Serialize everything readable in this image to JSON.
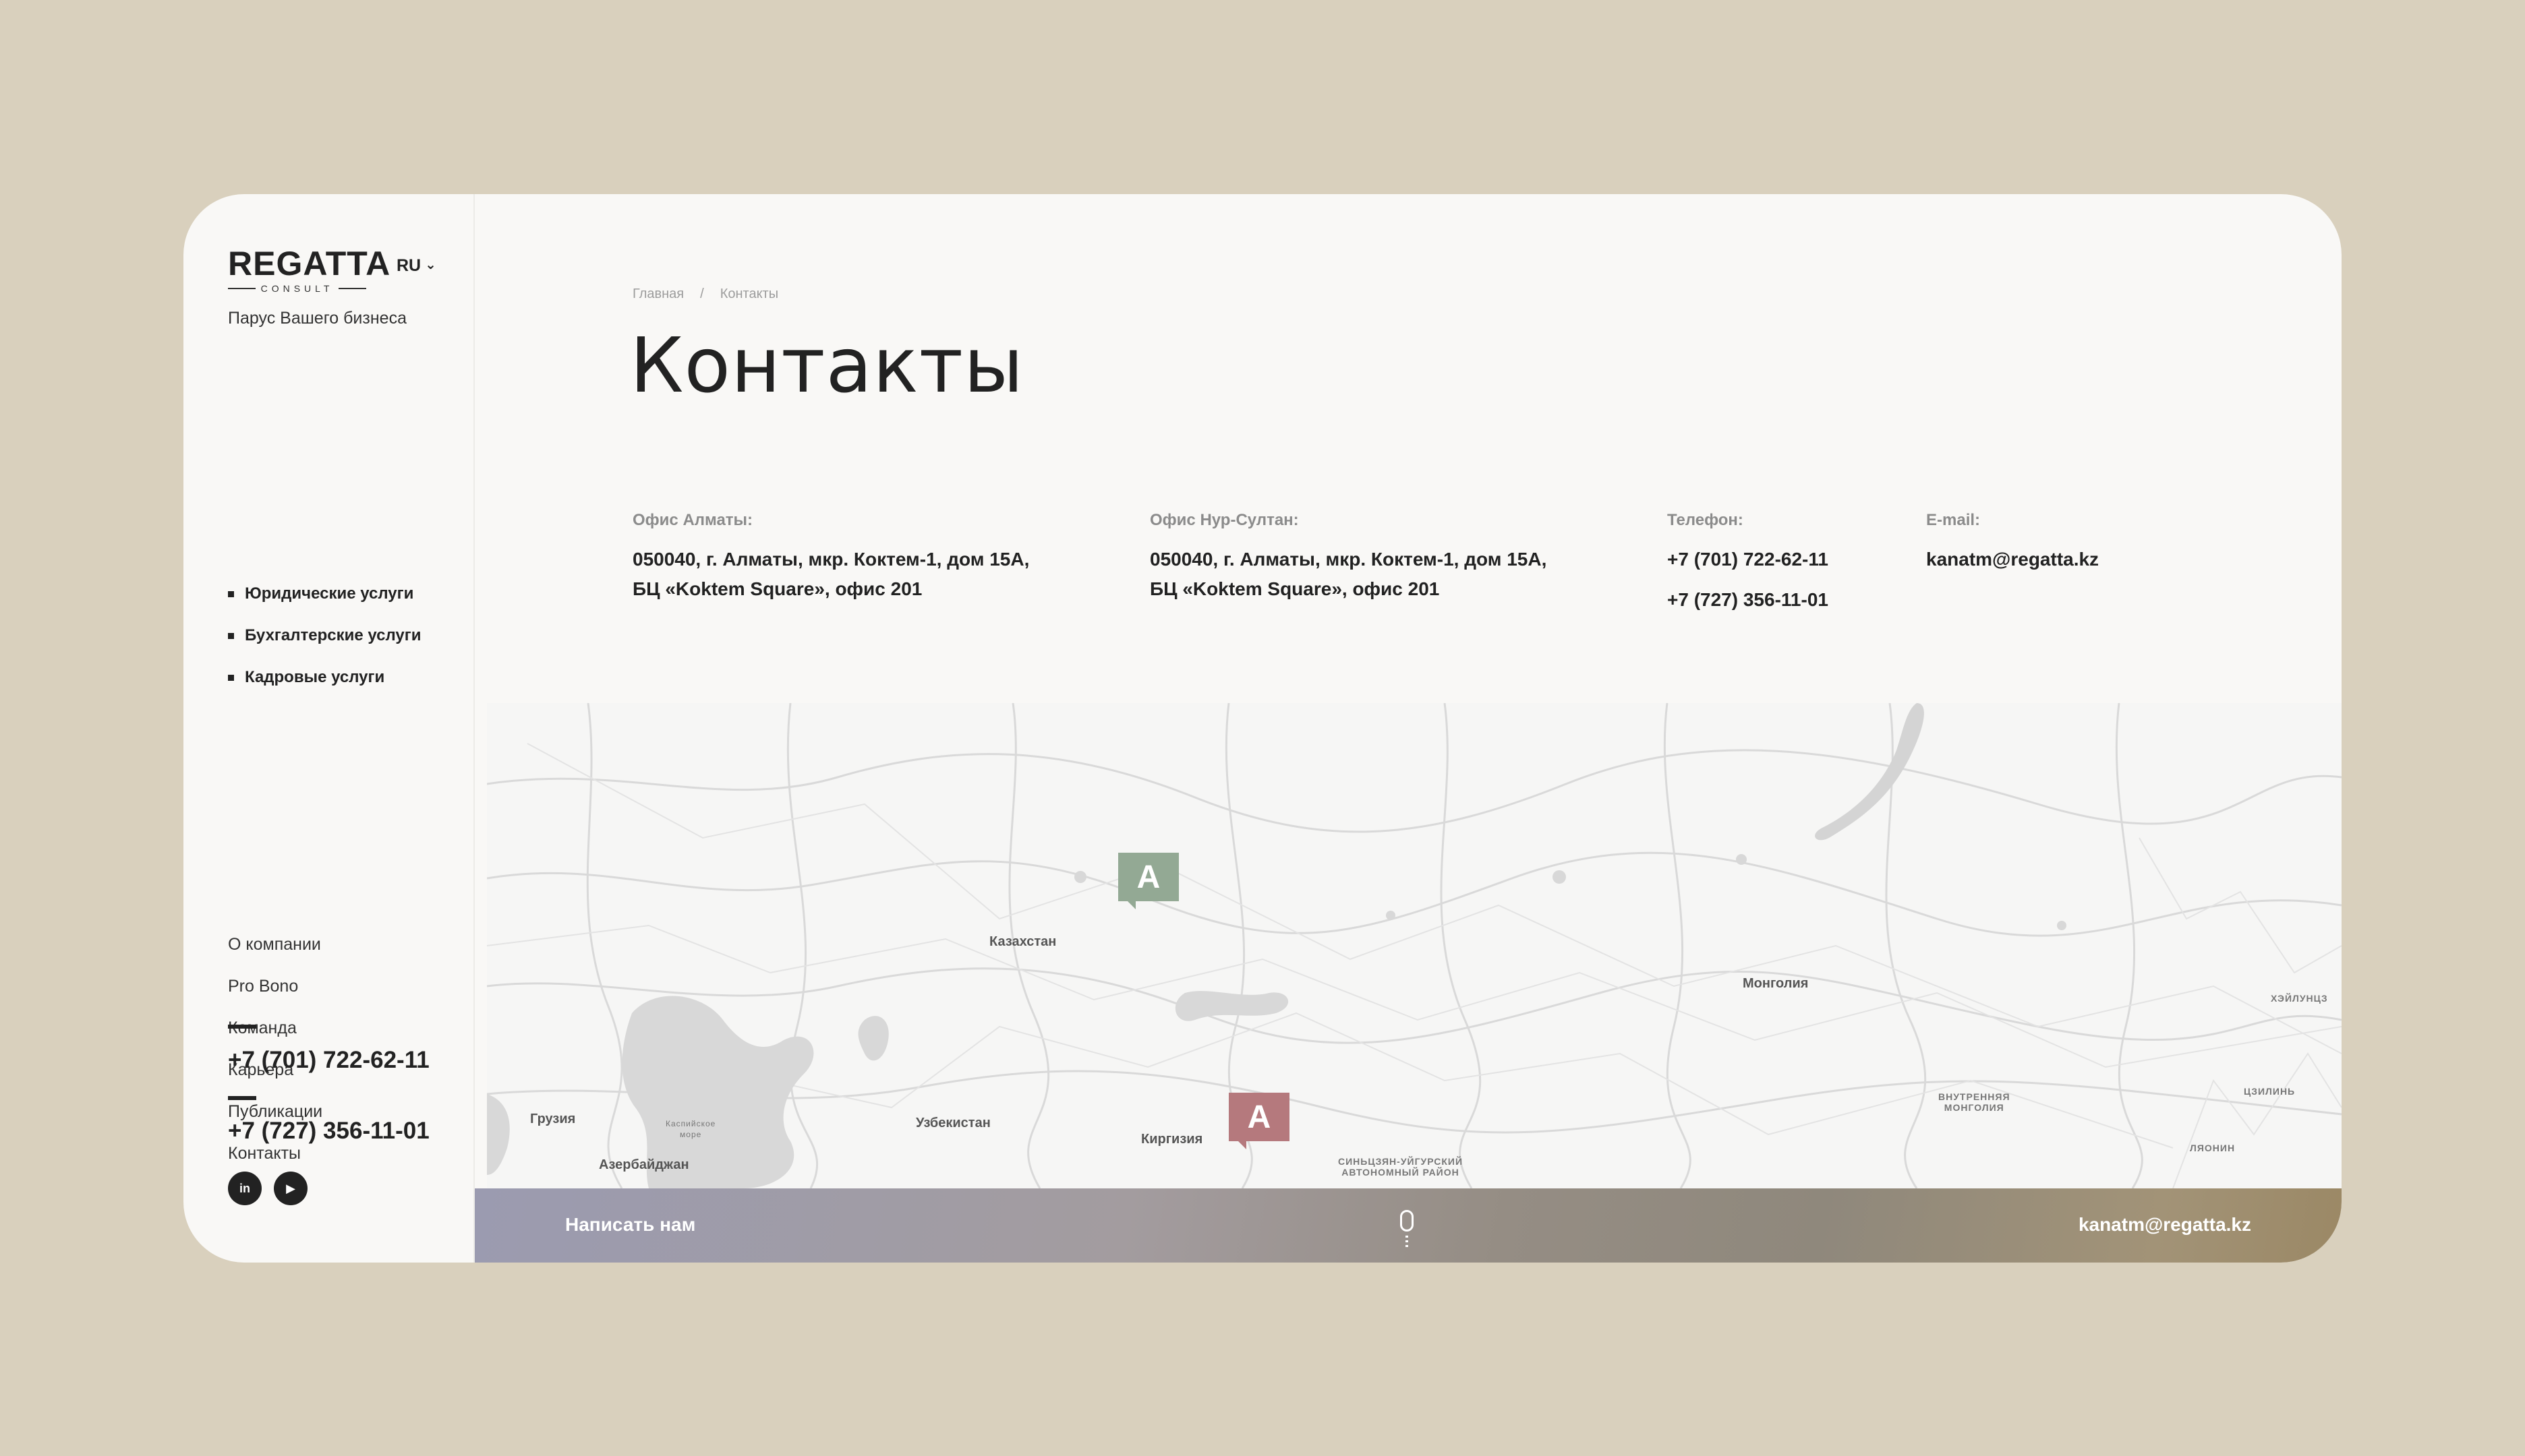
{
  "sidebar": {
    "logo": "REGATTA",
    "logo_sub": "CONSULT",
    "lang": "RU",
    "tagline": "Парус Вашего бизнеса",
    "services": [
      "Юридические услуги",
      "Бухгалтерские услуги",
      "Кадровые услуги"
    ],
    "nav": [
      "О компании",
      "Pro Bono",
      "Команда",
      "Карьера",
      "Публикации",
      "Контакты"
    ],
    "phones": [
      "+7 (701) 722-62-11",
      "+7 (727) 356-11-01"
    ],
    "social": [
      "linkedin-icon",
      "youtube-icon"
    ]
  },
  "breadcrumb": {
    "home": "Главная",
    "separator": "/",
    "current": "Контакты"
  },
  "page_title": "Контакты",
  "contacts": {
    "almaty": {
      "label": "Офис Алматы:",
      "line1": "050040, г. Алматы, мкр. Коктем-1, дом 15А,",
      "line2": "БЦ «Koktem Square», офис 201"
    },
    "nursultan": {
      "label": "Офис Нур-Султан:",
      "line1": "050040, г. Алматы, мкр. Коктем-1, дом 15А,",
      "line2": "БЦ «Koktem Square», офис 201"
    },
    "phone": {
      "label": "Телефон:",
      "values": [
        "+7 (701) 722-62-11",
        "+7 (727) 356-11-01"
      ]
    },
    "email": {
      "label": "E-mail:",
      "value": "kanatm@regatta.kz"
    }
  },
  "map": {
    "labels": [
      "Казахстан",
      "Монголия",
      "Узбекистан",
      "Киргизия",
      "Грузия",
      "Азербайджан",
      "СИНЬЦЗЯН-УЙГУРСКИЙ",
      "АВТОНОМНЫЙ РАЙОН",
      "ВНУТРЕННЯЯ",
      "МОНГОЛИЯ",
      "ХЭЙЛУНЦЗ",
      "ЦЗИЛИНЬ",
      "ЛЯОНИН",
      "Каспийское",
      "море"
    ],
    "marker_letter": "A",
    "marker_colors": [
      "#93a994",
      "#b5797d"
    ]
  },
  "contact_bar": {
    "write_us": "Написать нам",
    "email": "kanatm@regatta.kz"
  }
}
